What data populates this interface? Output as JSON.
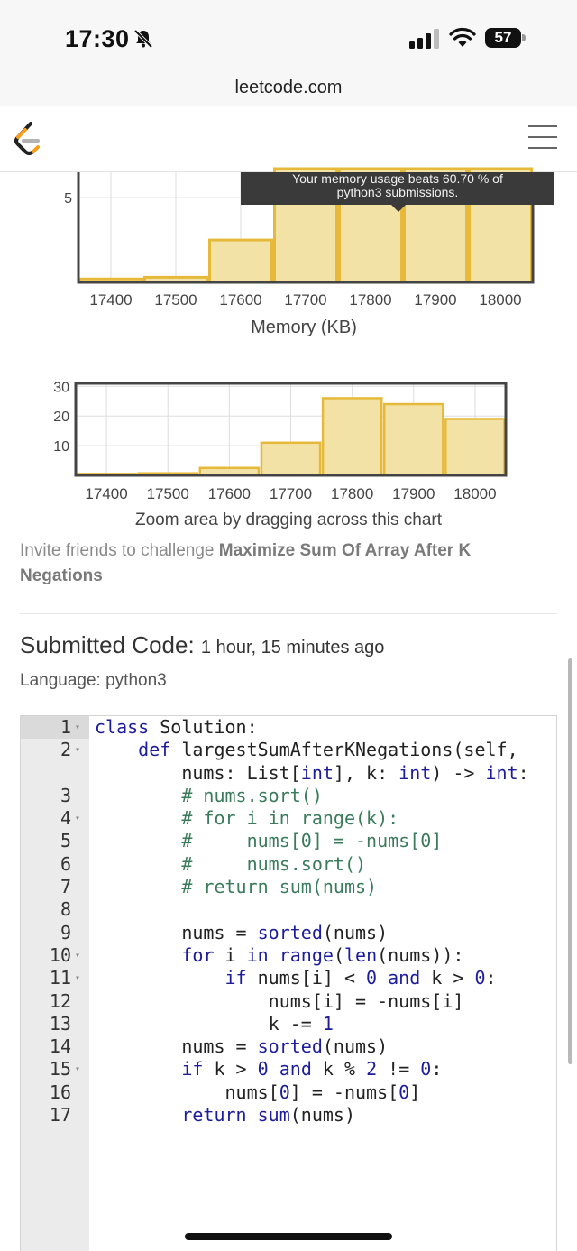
{
  "status_bar": {
    "time": "17:30",
    "battery": "57",
    "icons": [
      "bell-slash-icon",
      "signal-icon",
      "wifi-icon",
      "battery-icon"
    ]
  },
  "browser": {
    "url": "leetcode.com"
  },
  "nav": {
    "icons": [
      "leetcode-logo",
      "hamburger-menu-icon"
    ]
  },
  "tooltip": {
    "line1": "Your memory usage beats 60.70 % of",
    "line2": "python3 submissions."
  },
  "chart_data": [
    {
      "type": "bar",
      "xlabel": "Memory (KB)",
      "x_ticks": [
        "17400",
        "17500",
        "17600",
        "17700",
        "17800",
        "17900",
        "18000"
      ],
      "y_ticks": [
        "5"
      ],
      "bins": [
        [
          17350,
          17450
        ],
        [
          17450,
          17550
        ],
        [
          17550,
          17650
        ],
        [
          17650,
          17750
        ],
        [
          17750,
          17850
        ],
        [
          17850,
          17950
        ],
        [
          17950,
          18050
        ]
      ],
      "values": [
        0.2,
        0.3,
        2.5,
        8,
        8,
        8,
        8
      ],
      "ylim": [
        0,
        6.5
      ],
      "xlim": [
        17350,
        18050
      ],
      "grid": true,
      "color": "#f3e2a6",
      "edge_color": "#e6b93a"
    },
    {
      "type": "bar",
      "x_ticks": [
        "17400",
        "17500",
        "17600",
        "17700",
        "17800",
        "17900",
        "18000"
      ],
      "y_ticks": [
        "10",
        "20",
        "30"
      ],
      "bins": [
        [
          17350,
          17450
        ],
        [
          17450,
          17550
        ],
        [
          17550,
          17650
        ],
        [
          17650,
          17750
        ],
        [
          17750,
          17850
        ],
        [
          17850,
          17950
        ],
        [
          17950,
          18050
        ]
      ],
      "values": [
        0.5,
        0.7,
        2.5,
        11,
        26,
        24,
        19
      ],
      "ylim": [
        0,
        31
      ],
      "xlim": [
        17350,
        18050
      ],
      "grid": true,
      "color": "#f3e2a6",
      "edge_color": "#e6b93a"
    }
  ],
  "zoom_hint": "Zoom area by dragging across this chart",
  "invite": {
    "prefix": "Invite friends to challenge ",
    "problem": "Maximize Sum Of Array After K Negations"
  },
  "submission": {
    "title": "Submitted Code:",
    "time_ago": "1 hour, 15 minutes ago",
    "language_label": "Language: python3"
  },
  "code_lines": [
    {
      "num": "1",
      "fold": true,
      "text": "class Solution:"
    },
    {
      "num": "2",
      "fold": true,
      "text": "    def largestSumAfterKNegations(self,"
    },
    {
      "num": "",
      "fold": false,
      "text": "        nums: List[int], k: int) -> int:"
    },
    {
      "num": "3",
      "fold": false,
      "text": "        # nums.sort()"
    },
    {
      "num": "4",
      "fold": true,
      "text": "        # for i in range(k):"
    },
    {
      "num": "5",
      "fold": false,
      "text": "        #     nums[0] = -nums[0]"
    },
    {
      "num": "6",
      "fold": false,
      "text": "        #     nums.sort()"
    },
    {
      "num": "7",
      "fold": false,
      "text": "        # return sum(nums)"
    },
    {
      "num": "8",
      "fold": false,
      "text": ""
    },
    {
      "num": "9",
      "fold": false,
      "text": "        nums = sorted(nums)"
    },
    {
      "num": "10",
      "fold": true,
      "text": "        for i in range(len(nums)):"
    },
    {
      "num": "11",
      "fold": true,
      "text": "            if nums[i] < 0 and k > 0:"
    },
    {
      "num": "12",
      "fold": false,
      "text": "                nums[i] = -nums[i]"
    },
    {
      "num": "13",
      "fold": false,
      "text": "                k -= 1"
    },
    {
      "num": "14",
      "fold": false,
      "text": "        nums = sorted(nums)"
    },
    {
      "num": "15",
      "fold": true,
      "text": "        if k > 0 and k % 2 != 0:"
    },
    {
      "num": "16",
      "fold": false,
      "text": "            nums[0] = -nums[0]"
    },
    {
      "num": "17",
      "fold": false,
      "text": "        return sum(nums)"
    }
  ]
}
